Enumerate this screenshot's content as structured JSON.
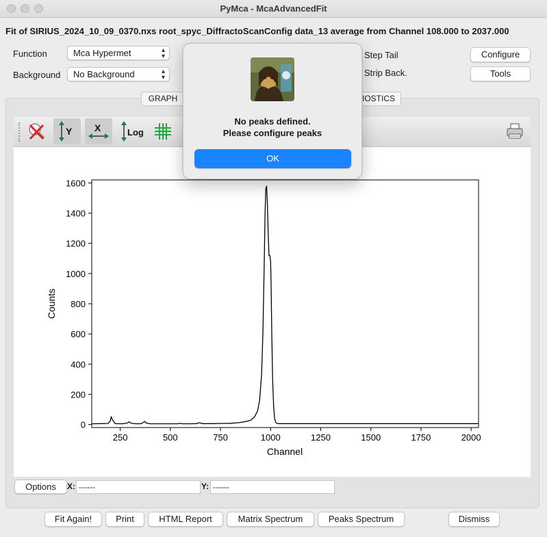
{
  "window": {
    "title": "PyMca - McaAdvancedFit"
  },
  "header": {
    "fit_title": "Fit of SIRIUS_2024_10_09_0370.nxs root_spyc_DiffractoScanConfig data_13 average from Channel 108.000 to 2037.000"
  },
  "controls": {
    "function_label": "Function",
    "function_value": "Mca Hypermet",
    "background_label": "Background",
    "background_value": "No Background",
    "step_tail_label": "Step Tail",
    "strip_back_label": "Strip Back.",
    "configure_label": "Configure",
    "tools_label": "Tools"
  },
  "tabs": [
    {
      "label": "GRAPH"
    },
    {
      "label": "IOSTICS"
    }
  ],
  "toolbar": {
    "icons": [
      "reset-zoom-icon",
      "autoscale-y-icon",
      "autoscale-x-icon",
      "log-scale-icon",
      "grid-icon",
      "print-icon"
    ],
    "y_label": "Y",
    "x_label": "X",
    "log_label": "Log"
  },
  "chart_data": {
    "type": "line",
    "title": "",
    "xlabel": "Channel",
    "ylabel": "Counts",
    "xlim": [
      108,
      2037
    ],
    "ylim": [
      -20,
      1620
    ],
    "xticks": [
      250,
      500,
      750,
      1000,
      1250,
      1500,
      1750,
      2000
    ],
    "yticks": [
      0,
      200,
      400,
      600,
      800,
      1000,
      1200,
      1400,
      1600
    ],
    "x": [
      108,
      150,
      190,
      200,
      205,
      212,
      225,
      260,
      285,
      295,
      305,
      330,
      355,
      365,
      372,
      380,
      400,
      500,
      540,
      548,
      560,
      600,
      630,
      645,
      660,
      700,
      750,
      800,
      840,
      870,
      900,
      920,
      935,
      945,
      955,
      962,
      968,
      972,
      976,
      980,
      984,
      988,
      992,
      996,
      1000,
      1003,
      1006,
      1010,
      1015,
      1020,
      1025,
      1030,
      1040,
      1060,
      1100,
      1200,
      1400,
      1600,
      1800,
      1900,
      2000,
      2037
    ],
    "series": [
      {
        "values": [
          5,
          6,
          7,
          22,
          50,
          30,
          6,
          5,
          10,
          18,
          8,
          5,
          6,
          14,
          20,
          10,
          5,
          5,
          5,
          8,
          5,
          5,
          6,
          12,
          6,
          6,
          7,
          8,
          12,
          18,
          28,
          50,
          90,
          160,
          330,
          620,
          1050,
          1380,
          1560,
          1580,
          1460,
          1260,
          1120,
          1120,
          1080,
          900,
          600,
          300,
          120,
          40,
          15,
          8,
          6,
          6,
          6,
          6,
          6,
          6,
          6,
          6,
          6,
          6
        ]
      }
    ]
  },
  "status": {
    "options_label": "Options",
    "x_label": "X:",
    "x_value": "------",
    "y_label": "Y:",
    "y_value": "------"
  },
  "bottom_buttons": {
    "fit_again": "Fit Again!",
    "print": "Print",
    "html_report": "HTML Report",
    "matrix_spectrum": "Matrix Spectrum",
    "peaks_spectrum": "Peaks Spectrum",
    "dismiss": "Dismiss"
  },
  "dialog": {
    "message_line1": "No peaks defined.",
    "message_line2": "Please configure peaks",
    "ok_label": "OK"
  },
  "colors": {
    "accent": "#1a84ff",
    "plot_line": "#000000",
    "grid_icon": "#1faa3a",
    "reset_icon": "#d8262c"
  }
}
